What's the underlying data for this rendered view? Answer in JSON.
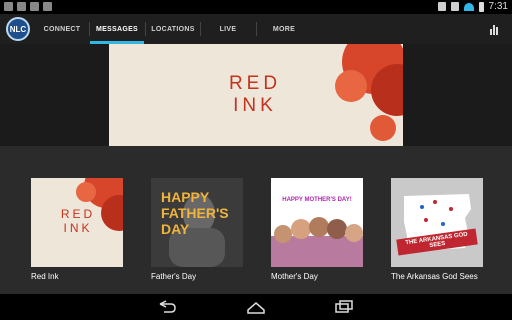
{
  "status_bar": {
    "time": "7:31",
    "accent": "#33b5e5"
  },
  "app": {
    "logo_text": "NLC"
  },
  "tabs": [
    {
      "label": "CONNECT",
      "active": false
    },
    {
      "label": "MESSAGES",
      "active": true
    },
    {
      "label": "LOCATIONS",
      "active": false
    },
    {
      "label": "LIVE",
      "active": false
    },
    {
      "label": "MORE",
      "active": false
    }
  ],
  "hero": {
    "title": "RED INK",
    "accent": "#c5321e"
  },
  "series": [
    {
      "title": "Red Ink",
      "thumb_text": "RED INK"
    },
    {
      "title": "Father's Day",
      "thumb_text": "HAPPY FATHER'S DAY"
    },
    {
      "title": "Mother's Day",
      "thumb_text": "HAPPY MOTHER'S DAY!"
    },
    {
      "title": "The Arkansas God Sees",
      "thumb_text": "THE ARKANSAS GOD SEES"
    }
  ],
  "icons": {
    "stats": "bar-chart-icon",
    "back": "back-icon",
    "home": "home-icon",
    "recents": "recent-apps-icon"
  }
}
